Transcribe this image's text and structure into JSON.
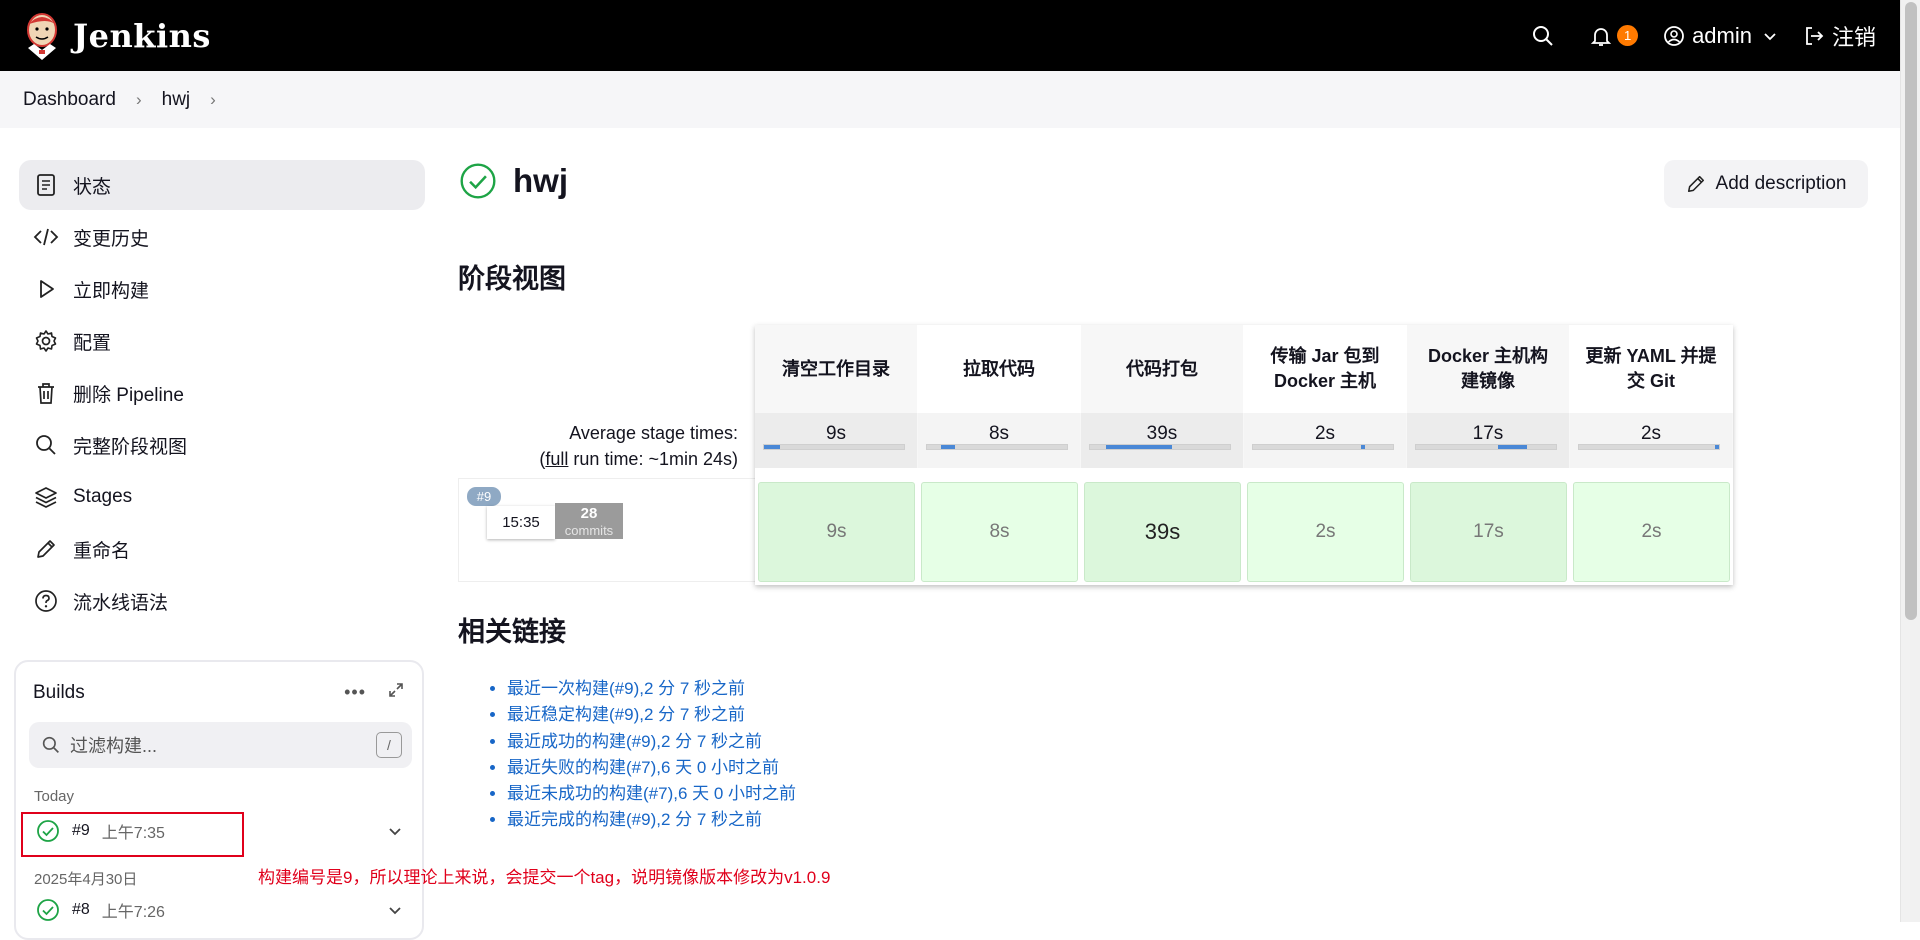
{
  "header": {
    "app_name": "Jenkins",
    "notification_count": "1",
    "user": "admin",
    "logout": "注销",
    "bg_color": "#000000",
    "badge_color": "#ff7a00"
  },
  "breadcrumb": [
    "Dashboard",
    "hwj"
  ],
  "sidebar": {
    "items": [
      {
        "label": "状态",
        "icon": "document-icon"
      },
      {
        "label": "变更历史",
        "icon": "code-icon"
      },
      {
        "label": "立即构建",
        "icon": "play-icon"
      },
      {
        "label": "配置",
        "icon": "gear-icon"
      },
      {
        "label": "删除 Pipeline",
        "icon": "trash-icon"
      },
      {
        "label": "完整阶段视图",
        "icon": "search-icon"
      },
      {
        "label": "Stages",
        "icon": "layers-icon"
      },
      {
        "label": "重命名",
        "icon": "pencil-icon"
      },
      {
        "label": "流水线语法",
        "icon": "help-icon"
      }
    ]
  },
  "builds": {
    "title": "Builds",
    "filter_placeholder": "过滤构建...",
    "filter_key": "/",
    "groups": [
      {
        "label": "Today",
        "builds": [
          {
            "number": "#9",
            "time": "上午7:35"
          }
        ]
      },
      {
        "label": "2025年4月30日",
        "builds": [
          {
            "number": "#8",
            "time": "上午7:26"
          }
        ]
      }
    ]
  },
  "main": {
    "job_name": "hwj",
    "add_description": "Add description",
    "stage_view_title": "阶段视图",
    "related_links_title": "相关链接"
  },
  "stage_view": {
    "stages": [
      {
        "name": "清空工作目录",
        "avg": "9s",
        "run": "9s",
        "avg_fraction": 0.11
      },
      {
        "name": "拉取代码",
        "avg": "8s",
        "run": "8s",
        "avg_fraction": 0.1
      },
      {
        "name": "代码打包",
        "avg": "39s",
        "run": "39s",
        "avg_fraction": 0.46
      },
      {
        "name": "传输 Jar 包到 Docker 主机",
        "avg": "2s",
        "run": "2s",
        "avg_fraction": 0.02
      },
      {
        "name": "Docker 主机构建镜像",
        "avg": "17s",
        "run": "17s",
        "avg_fraction": 0.2
      },
      {
        "name": "更新 YAML 并提交 Git",
        "avg": "2s",
        "run": "2s",
        "avg_fraction": 0.02
      }
    ],
    "avg_label_line1": "Average stage times:",
    "avg_label_line2_prefix": "(",
    "avg_label_line2_link": "full",
    "avg_label_line2_suffix": " run time: ~1min 24s)",
    "run": {
      "badge": "#9",
      "time": "15:35",
      "commits": "28",
      "commits_label": "commits"
    }
  },
  "related_links": [
    "最近一次构建(#9),2 分 7 秒之前",
    "最近稳定构建(#9),2 分 7 秒之前",
    "最近成功的构建(#9),2 分 7 秒之前",
    "最近失败的构建(#7),6 天 0 小时之前",
    "最近未成功的构建(#7),6 天 0 小时之前",
    "最近完成的构建(#9),2 分 7 秒之前"
  ],
  "annotation": "构建编号是9，所以理论上来说，会提交一个tag，说明镜像版本修改为v1.0.9",
  "colors": {
    "success_green": "#1ea446",
    "link_blue": "#1766c7",
    "annotation_red": "#e0001b",
    "stage_cell_green": "#dcf7dc"
  }
}
